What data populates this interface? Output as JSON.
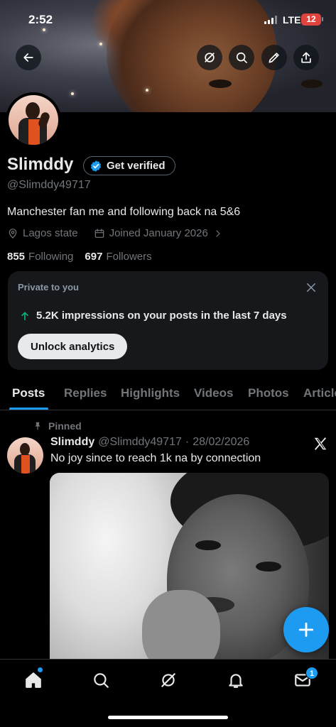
{
  "status_bar": {
    "time": "2:52",
    "network": "LTE",
    "battery": "12",
    "battery_color": "#e0443e"
  },
  "header_actions": {
    "back_icon": "arrow-left-icon",
    "grok_icon": "grok-icon",
    "search_icon": "search-icon",
    "edit_icon": "pencil-icon",
    "share_icon": "share-icon"
  },
  "profile": {
    "name": "Slimddy",
    "get_verified_label": "Get verified",
    "handle": "@Slimddy49717",
    "bio": "Manchester fan me and following back na 5&6",
    "location": "Lagos state",
    "joined": "Joined January 2026",
    "following_count": "855",
    "following_label": "Following",
    "followers_count": "697",
    "followers_label": "Followers"
  },
  "analytics_card": {
    "private_label": "Private to you",
    "impressions_text": "5.2K impressions on your posts in the last 7 days",
    "unlock_label": "Unlock analytics",
    "trend_color": "#00ba7c"
  },
  "tabs": [
    {
      "label": "Posts",
      "active": true
    },
    {
      "label": "Replies",
      "active": false
    },
    {
      "label": "Highlights",
      "active": false
    },
    {
      "label": "Videos",
      "active": false
    },
    {
      "label": "Photos",
      "active": false
    },
    {
      "label": "Articles",
      "active": false
    }
  ],
  "post": {
    "pinned_label": "Pinned",
    "author_name": "Slimddy",
    "author_handle": "@Slimddy49717",
    "separator": "·",
    "date": "28/02/2026",
    "text": "No joy since to reach 1k na by connection"
  },
  "bottom_nav": {
    "items": [
      "home-icon",
      "search-icon",
      "grok-icon",
      "bell-icon",
      "mail-icon"
    ],
    "messages_badge": "1"
  },
  "colors": {
    "accent": "#1d9bf0",
    "background": "#000000",
    "muted_text": "#71767b"
  }
}
